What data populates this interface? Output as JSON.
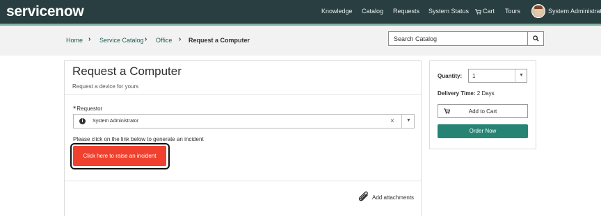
{
  "header": {
    "logo": "servicenow",
    "nav": {
      "knowledge": "Knowledge",
      "catalog": "Catalog",
      "requests": "Requests",
      "system_status": "System Status",
      "cart": "Cart",
      "tours": "Tours",
      "user": "System Administrator"
    }
  },
  "breadcrumb": {
    "home": "Home",
    "service_catalog": "Service Catalog",
    "office": "Office",
    "current": "Request a Computer"
  },
  "search": {
    "value": "Search Catalog"
  },
  "form": {
    "title": "Request a Computer",
    "subtitle": "Request a device for yours",
    "requestor_label": "Requestor",
    "requestor_required_mark": "*",
    "requestor_value": "System Administrator",
    "requestor_clear": "×",
    "instruction": "Please click on the link below to generate an incident",
    "incident_button": "Click here to raise an incident",
    "attachments": "Add attachments"
  },
  "order_panel": {
    "quantity_label": "Quantity:",
    "quantity_value": "1",
    "delivery_label": "Delivery Time:",
    "delivery_value": "2 Days",
    "add_to_cart": "Add to Cart",
    "order_now": "Order Now"
  },
  "colors": {
    "header_bg": "#293e40",
    "accent_green": "#278475",
    "incident_red": "#f0402e"
  }
}
